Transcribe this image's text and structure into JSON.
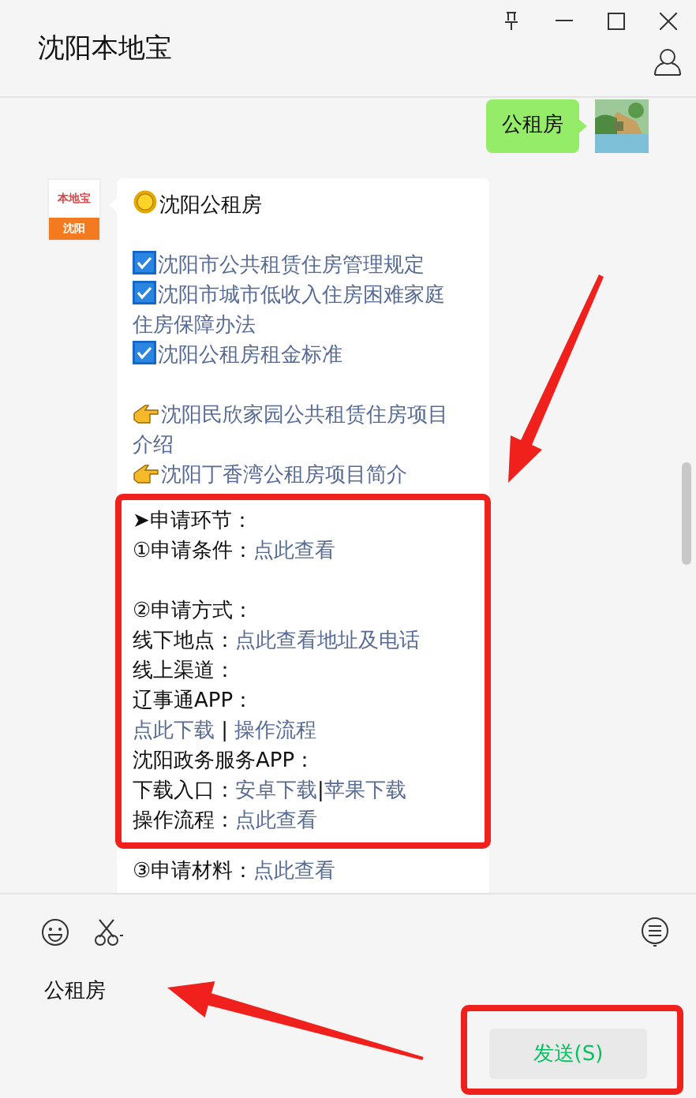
{
  "window": {
    "title": "沈阳本地宝"
  },
  "messages": [
    {
      "kind": "outgoing",
      "text": "公租房"
    },
    {
      "kind": "incoming",
      "avatar": {
        "brand": "本地宝",
        "city": "沈阳"
      },
      "sections": [
        {
          "highlighted": false,
          "lines": [
            {
              "kind": "sun",
              "parts": [
                {
                  "kind": "text",
                  "text": "沈阳公租房"
                }
              ]
            },
            {
              "kind": "blank"
            },
            {
              "kind": "check",
              "parts": [
                {
                  "kind": "link",
                  "text": "沈阳市公共租赁住房管理规定"
                }
              ]
            },
            {
              "kind": "check",
              "parts": [
                {
                  "kind": "link",
                  "text": "沈阳市城市低收入住房困难家庭"
                }
              ]
            },
            {
              "kind": "plain",
              "parts": [
                {
                  "kind": "link",
                  "text": "住房保障办法"
                }
              ]
            },
            {
              "kind": "check",
              "parts": [
                {
                  "kind": "link",
                  "text": "沈阳公租房租金标准"
                }
              ]
            },
            {
              "kind": "blank"
            },
            {
              "kind": "hand",
              "parts": [
                {
                  "kind": "link",
                  "text": "沈阳民欣家园公共租赁住房项目"
                }
              ]
            },
            {
              "kind": "plain",
              "parts": [
                {
                  "kind": "link",
                  "text": "介绍"
                }
              ]
            },
            {
              "kind": "hand",
              "parts": [
                {
                  "kind": "link",
                  "text": "沈阳丁香湾公租房项目简介"
                }
              ]
            }
          ]
        },
        {
          "highlighted": true,
          "lines": [
            {
              "kind": "plain",
              "parts": [
                {
                  "kind": "text",
                  "text": "➤申请环节："
                }
              ]
            },
            {
              "kind": "plain",
              "parts": [
                {
                  "kind": "text",
                  "text": "①申请条件："
                },
                {
                  "kind": "link",
                  "text": "点此查看"
                }
              ]
            },
            {
              "kind": "blank"
            },
            {
              "kind": "plain",
              "parts": [
                {
                  "kind": "text",
                  "text": "②申请方式："
                }
              ]
            },
            {
              "kind": "plain",
              "parts": [
                {
                  "kind": "text",
                  "text": "线下地点："
                },
                {
                  "kind": "link",
                  "text": "点此查看地址及电话"
                }
              ]
            },
            {
              "kind": "plain",
              "parts": [
                {
                  "kind": "text",
                  "text": "线上渠道："
                }
              ]
            },
            {
              "kind": "plain",
              "parts": [
                {
                  "kind": "text",
                  "text": "辽事通APP："
                }
              ]
            },
            {
              "kind": "plain",
              "parts": [
                {
                  "kind": "link",
                  "text": "点此下载"
                },
                {
                  "kind": "text",
                  "text": " | "
                },
                {
                  "kind": "link",
                  "text": "操作流程"
                }
              ]
            },
            {
              "kind": "plain",
              "parts": [
                {
                  "kind": "text",
                  "text": "沈阳政务服务APP："
                }
              ]
            },
            {
              "kind": "plain",
              "parts": [
                {
                  "kind": "text",
                  "text": "下载入口："
                },
                {
                  "kind": "link",
                  "text": "安卓下载"
                },
                {
                  "kind": "text",
                  "text": "|"
                },
                {
                  "kind": "link",
                  "text": "苹果下载"
                }
              ]
            },
            {
              "kind": "plain",
              "parts": [
                {
                  "kind": "text",
                  "text": "操作流程："
                },
                {
                  "kind": "link",
                  "text": "点此查看"
                }
              ]
            }
          ]
        },
        {
          "highlighted": false,
          "lines": [
            {
              "kind": "plain",
              "parts": [
                {
                  "kind": "text",
                  "text": "③申请材料："
                },
                {
                  "kind": "link",
                  "text": "点此查看"
                }
              ]
            }
          ]
        }
      ]
    }
  ],
  "input": {
    "value": "公租房"
  },
  "send_button": {
    "label": "发送(S)",
    "highlighted": true
  }
}
